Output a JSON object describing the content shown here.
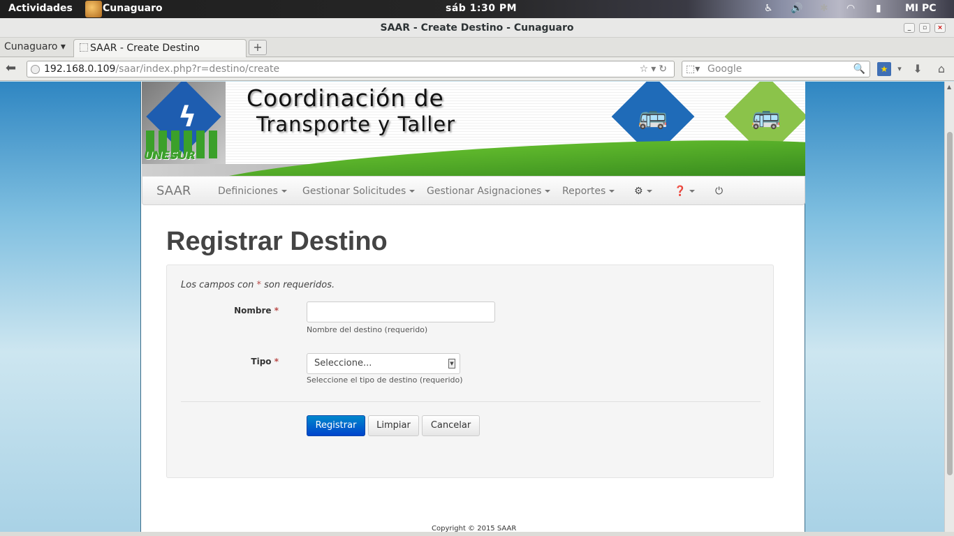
{
  "system": {
    "activities": "Actividades",
    "app_name": "Cunaguaro",
    "clock": "sáb  1:30 PM",
    "user": "MI PC",
    "tray_icons": [
      "accessibility-icon",
      "volume-icon",
      "bluetooth-icon",
      "wifi-icon",
      "battery-icon"
    ]
  },
  "window": {
    "title": "SAAR - Create Destino - Cunaguaro"
  },
  "browser": {
    "tab_group": "Cunaguaro",
    "tab_title": "SAAR - Create Destino",
    "url_host": "192.168.0.109",
    "url_path": "/saar/index.php?r=destino/create",
    "search_placeholder": "Google"
  },
  "banner": {
    "logo_text": "UNESUR",
    "line1": "Coordinación de",
    "line2": "Transporte y Taller"
  },
  "nav": {
    "brand": "SAAR",
    "items": [
      {
        "label": "Definiciones"
      },
      {
        "label": "Gestionar Solicitudes"
      },
      {
        "label": "Gestionar Asignaciones"
      },
      {
        "label": "Reportes"
      }
    ],
    "icons": [
      "gear-icon",
      "help-icon",
      "power-icon"
    ]
  },
  "page": {
    "title": "Registrar Destino",
    "required_note_prefix": "Los campos con ",
    "required_mark": "*",
    "required_note_suffix": " son requeridos.",
    "copyright": "Copyright © 2015 SAAR"
  },
  "form": {
    "nombre_label": "Nombre",
    "nombre_value": "",
    "nombre_help": "Nombre del destino (requerido)",
    "tipo_label": "Tipo",
    "tipo_selected": "Seleccione...",
    "tipo_help": "Seleccione el tipo de destino (requerido)",
    "submit": "Registrar",
    "reset": "Limpiar",
    "cancel": "Cancelar"
  },
  "colors": {
    "primary_button": "#0055cc",
    "required": "#b94a48",
    "bus_blue": "#1f6bb8",
    "bus_green": "#8bc34a"
  }
}
